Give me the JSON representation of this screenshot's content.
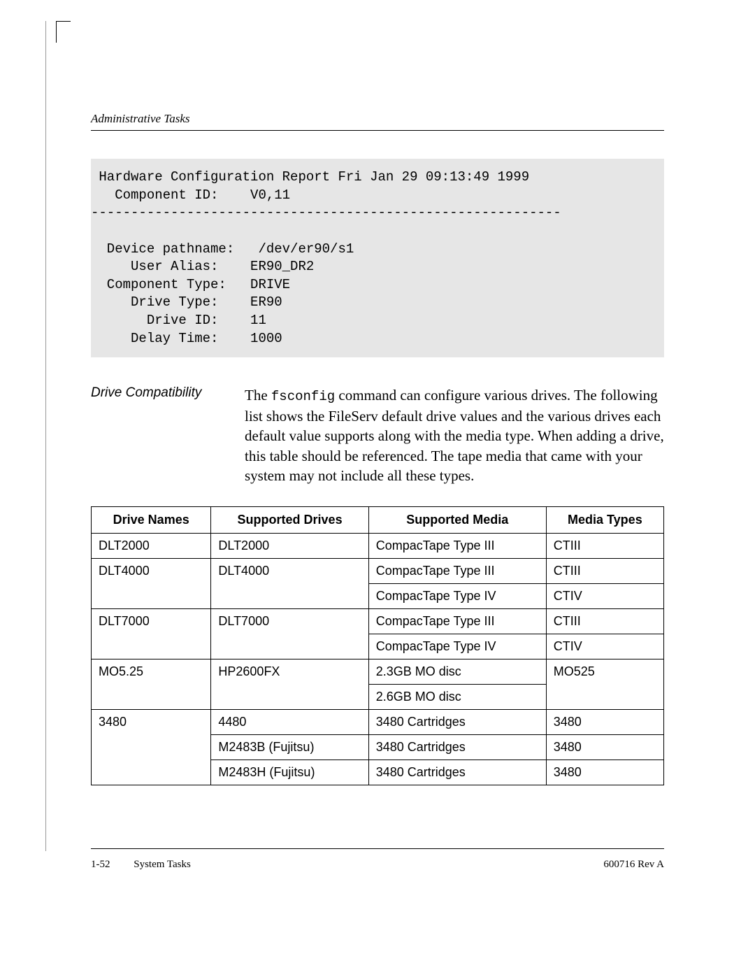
{
  "header": {
    "running_head": "Administrative Tasks"
  },
  "code": {
    "line1": " Hardware Configuration Report Fri Jan 29 09:13:49 1999",
    "line2": "   Component ID:    V0,11",
    "rule": "-----------------------------------------------------------",
    "l_dev": "  Device pathname:   /dev/er90/s1",
    "l_alias": "     User Alias:    ER90_DR2",
    "l_ctype": "  Component Type:   DRIVE",
    "l_dtype": "     Drive Type:    ER90",
    "l_did": "       Drive ID:    11",
    "l_delay": "     Delay Time:    1000"
  },
  "section": {
    "side_label": "Drive Compatibility",
    "para_pre": "The ",
    "para_cmd": "fsconfig",
    "para_post": " command can configure various drives. The following list shows the FileServ default drive values and the various drives each default value supports along with the media type. When adding a drive, this table should be referenced. The tape media that came with your system may not include all these types."
  },
  "table": {
    "headers": {
      "c1": "Drive Names",
      "c2": "Supported Drives",
      "c3": "Supported Media",
      "c4": "Media Types"
    },
    "rows": {
      "r1": {
        "name": "DLT2000",
        "drive": "DLT2000",
        "media": "CompacTape Type III",
        "mtype": "CTIII"
      },
      "r2": {
        "name": "DLT4000",
        "drive": "DLT4000",
        "media": "CompacTape Type III",
        "mtype": "CTIII"
      },
      "r2b": {
        "media": "CompacTape Type IV",
        "mtype": "CTIV"
      },
      "r3": {
        "name": "DLT7000",
        "drive": "DLT7000",
        "media": "CompacTape Type III",
        "mtype": "CTIII"
      },
      "r3b": {
        "media": "CompacTape Type IV",
        "mtype": "CTIV"
      },
      "r4": {
        "name": "MO5.25",
        "drive": "HP2600FX",
        "media": "2.3GB MO disc",
        "mtype": "MO525"
      },
      "r4b": {
        "media": "2.6GB MO disc"
      },
      "r5": {
        "name": "3480",
        "drive": "4480",
        "media": "3480 Cartridges",
        "mtype": "3480"
      },
      "r5b": {
        "drive": "M2483B (Fujitsu)",
        "media": "3480 Cartridges",
        "mtype": "3480"
      },
      "r5c": {
        "drive": "M2483H (Fujitsu)",
        "media": "3480 Cartridges",
        "mtype": "3480"
      }
    }
  },
  "footer": {
    "page": "1-52",
    "section": "System Tasks",
    "docno": "600716 Rev A"
  }
}
